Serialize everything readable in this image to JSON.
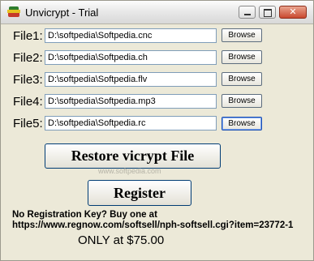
{
  "window": {
    "title": "Unvicrypt - Trial"
  },
  "files": [
    {
      "label": "File1:",
      "value": "D:\\softpedia\\Softpedia.cnc",
      "button": "Browse"
    },
    {
      "label": "File2:",
      "value": "D:\\softpedia\\Softpedia.ch",
      "button": "Browse"
    },
    {
      "label": "File3:",
      "value": "D:\\softpedia\\Softpedia.flv",
      "button": "Browse"
    },
    {
      "label": "File4:",
      "value": "D:\\softpedia\\Softpedia.mp3",
      "button": "Browse"
    },
    {
      "label": "File5:",
      "value": "D:\\softpedia\\Softpedia.rc",
      "button": "Browse"
    }
  ],
  "actions": {
    "restore_label": "Restore vicrypt File",
    "register_label": "Register"
  },
  "watermark": "www.softpedia.com",
  "registration": {
    "line1": "No Registration Key?  Buy one at",
    "line2": "https://www.regnow.com/softsell/nph-softsell.cgi?item=23772-1",
    "price": "ONLY at $75.00"
  }
}
